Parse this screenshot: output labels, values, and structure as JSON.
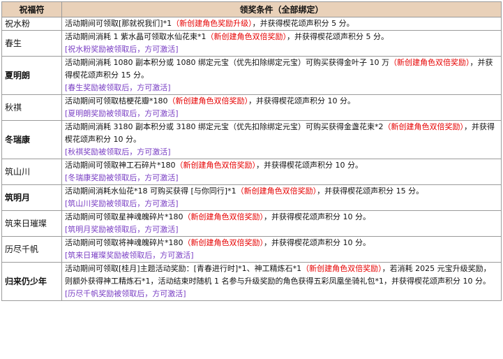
{
  "header": {
    "col_name": "祝福符",
    "col_cond": "领奖条件（全部绑定）"
  },
  "rows": [
    {
      "name": "祝水粉",
      "bold": false,
      "a": "活动期间可领取[那就祝我们]*1",
      "red": "（新创建角色奖励升级）",
      "b": "，并获得楔花颂声积分 5 分。",
      "note": ""
    },
    {
      "name": "春生",
      "bold": false,
      "a": "活动期间消耗 1 紫水晶可领取水仙花束*1",
      "red": "（新创建角色双倍奖励）",
      "b": "，并获得楔花颂声积分 5 分。",
      "note": "[祝水粉奖励被领取后，方可激活]"
    },
    {
      "name": "夏明朗",
      "bold": true,
      "a": "活动期间消耗 1080 副本积分或 1080 绑定元宝（优先扣除绑定元宝）可购买获得金叶子 10 万",
      "red": "（新创建角色双倍奖励）",
      "b": "，并获得楔花颂声积分 15 分。",
      "note": "[春生奖励被领取后，方可激活]"
    },
    {
      "name": "秋祺",
      "bold": false,
      "a": "活动期间可领取桔梗花瓣*180",
      "red": "（新创建角色双倍奖励）",
      "b": "，并获得楔花颂声积分 10 分。",
      "note": "[夏明朗奖励被领取后，方可激活]"
    },
    {
      "name": "冬瑞康",
      "bold": true,
      "a": "活动期间消耗 3180 副本积分或 3180 绑定元宝（优先扣除绑定元宝）可购买获得金盏花束*2",
      "red": "（新创建角色双倍奖励）",
      "b": "，并获得楔花颂声积分 10 分。",
      "note": "[秋祺奖励被领取后，方可激活]"
    },
    {
      "name": "筑山川",
      "bold": false,
      "a": "活动期间可领取神工石碎片*180",
      "red": "（新创建角色双倍奖励）",
      "b": "，并获得楔花颂声积分 10 分。",
      "note": "[冬瑞康奖励被领取后，方可激活]"
    },
    {
      "name": "筑明月",
      "bold": true,
      "a": "活动期间消耗水仙花*18 可购买获得 [与你同行]*1",
      "red": "（新创建角色双倍奖励）",
      "b": "，并获得楔花颂声积分 15 分。",
      "note": "[筑山川奖励被领取后，方可激活]"
    },
    {
      "name": "筑来日璀璨",
      "bold": false,
      "a": "活动期间可领取星神魂魄碎片*180",
      "red": "（新创建角色双倍奖励）",
      "b": "，并获得楔花颂声积分 10 分。",
      "note": "[筑明月奖励被领取后，方可激活]"
    },
    {
      "name": "历尽千帆",
      "bold": false,
      "a": "活动期间可领取将神魂魄碎片*180",
      "red": "（新创建角色双倍奖励）",
      "b": "，并获得楔花颂声积分 10 分。",
      "note": "[筑来日璀璨奖励被领取后，方可激活]"
    },
    {
      "name": "归来仍少年",
      "bold": true,
      "a": "活动期间可领取[桂月]主题活动奖励：[青春进行时]*1、神工精炼石*1",
      "red": "（新创建角色双倍奖励）",
      "b": "，若消耗 2025 元宝升级奖励，则额外获得神工精炼石*1，活动结束时随机 1 名参与升级奖励的角色获得五彩凤凰坐骑礼包*1，并获得楔花颂声积分 10 分。",
      "note": "[历尽千帆奖励被领取后，方可激活]"
    }
  ]
}
